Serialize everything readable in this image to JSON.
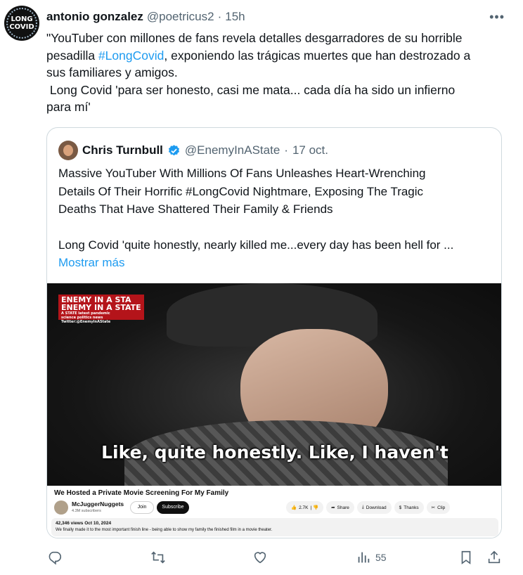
{
  "tweet": {
    "avatar": {
      "line1": "LONG",
      "line2": "COVID"
    },
    "author_name": "antonio gonzalez",
    "author_handle": "@poetricus2",
    "separator": "·",
    "time": "15h",
    "more_icon": "more-dots-icon",
    "text_line1": "\"YouTuber con millones de fans revela detalles desgarradores de su horrible",
    "text_line2_pre": "pesadilla ",
    "hashtag": "#LongCovid",
    "text_line2_post": ", exponiendo las trágicas muertes que han destrozado a",
    "text_line3": "sus familiares y amigos.",
    "text_line4": " Long Covid 'para ser honesto, casi me mata... cada día ha sido un infierno",
    "text_line5": "para mí'"
  },
  "quote": {
    "author_name": "Chris Turnbull",
    "verified_icon": "verified-badge-icon",
    "author_handle": "@EnemyInAState",
    "separator": "·",
    "time": "17 oct.",
    "line1": "Massive YouTuber With Millions Of Fans Unleashes Heart-Wrenching",
    "line2": "Details Of Their Horrific #LongCovid Nightmare, Exposing The Tragic",
    "line3": "Deaths That Have Shattered Their Family & Friends",
    "line4": "Long Covid 'quite honestly, nearly killed me...every day has been hell for ...",
    "show_more": "Mostrar más"
  },
  "video": {
    "logo_line1": "ENEMY IN A STA",
    "logo_line2": "ENEMY IN A STATE",
    "logo_line3": "A STATE latest pandemic",
    "logo_line4": "science politics news",
    "logo_line5": "Twitter:@EnemyInAState",
    "subtitle": "Like, quite honestly. Like, I haven't"
  },
  "youtube": {
    "title": "We Hosted a Private Movie Screening For My Family",
    "channel": "McJuggerNuggets",
    "subscribers": "4.3M subscribers",
    "join": "Join",
    "subscribe": "Subscribe",
    "likes": "2.7K",
    "share": "Share",
    "download": "Download",
    "thanks": "Thanks",
    "clip": "Clip",
    "views": "42,346 views  Oct 10, 2024",
    "description": "We finally made it to the most important finish line - being able to show my family the finished film in a movie theater."
  },
  "actions": {
    "reply_icon": "reply-icon",
    "retweet_icon": "retweet-icon",
    "like_icon": "heart-icon",
    "views_icon": "views-icon",
    "views_count": "55",
    "bookmark_icon": "bookmark-icon",
    "share_icon": "share-icon"
  },
  "colors": {
    "link": "#1d9bf0",
    "secondary_text": "#536471",
    "border": "#cfd9de",
    "logo_red": "#b4141a"
  }
}
